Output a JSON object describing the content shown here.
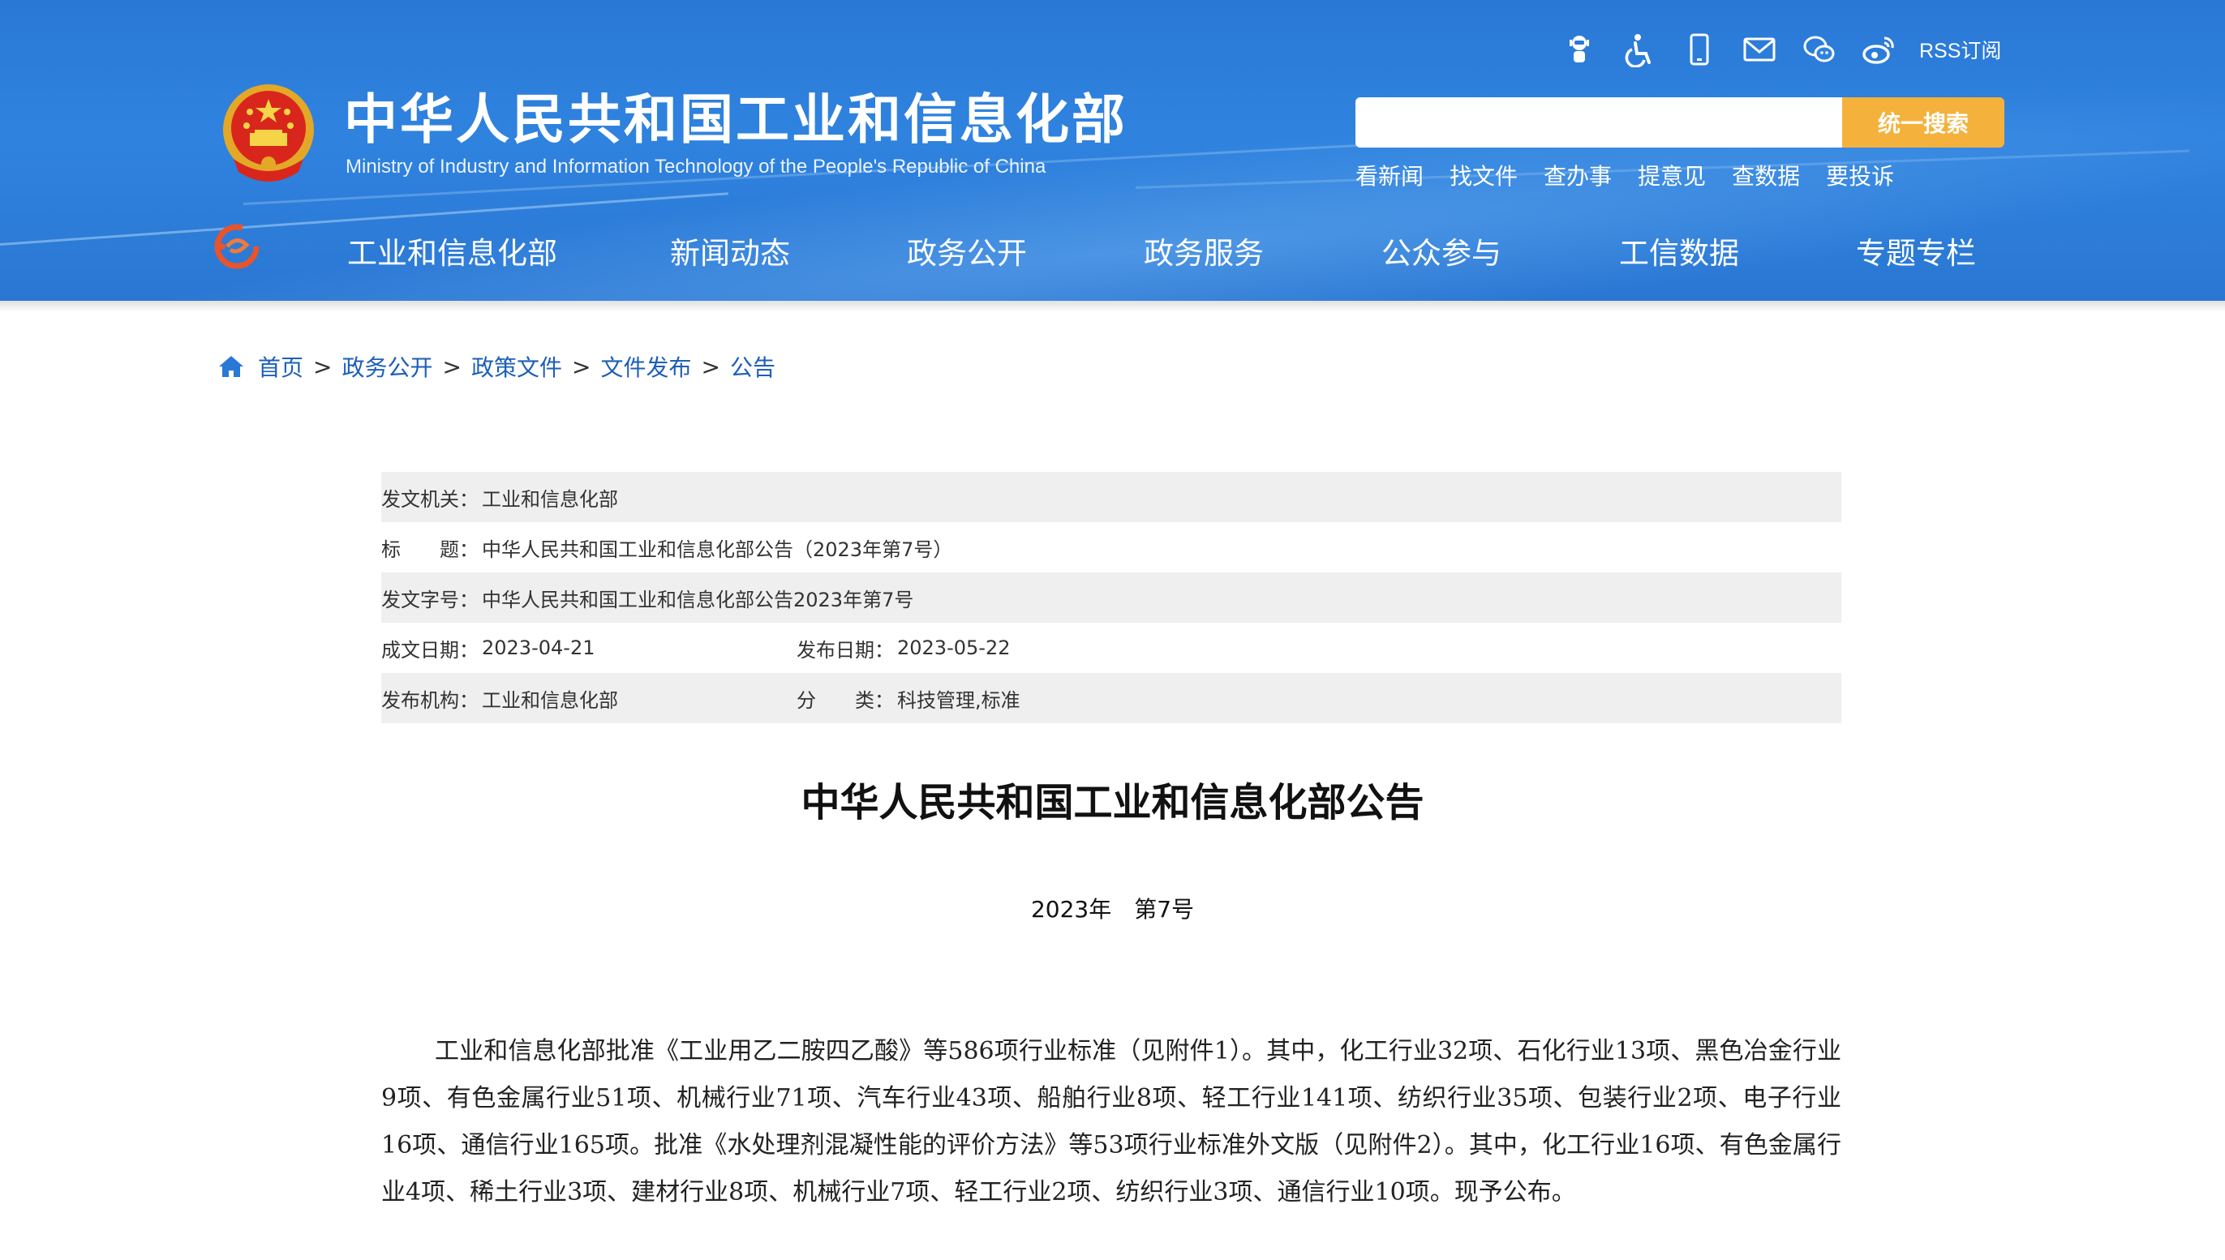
{
  "site": {
    "title": "中华人民共和国工业和信息化部",
    "subtitle": "Ministry of Industry and Information Technology of the People's Republic of China",
    "header_color": "#2f83df",
    "accent_color": "#f4b23c"
  },
  "utility": {
    "icons": [
      "robot-icon",
      "accessibility-icon",
      "mobile-icon",
      "mail-icon",
      "wechat-icon",
      "weibo-icon"
    ],
    "rss_label": "RSS订阅"
  },
  "search": {
    "placeholder": "",
    "button_label": "统一搜索",
    "quick_links": [
      "看新闻",
      "找文件",
      "查办事",
      "提意见",
      "查数据",
      "要投诉"
    ]
  },
  "nav": {
    "items": [
      "工业和信息化部",
      "新闻动态",
      "政务公开",
      "政务服务",
      "公众参与",
      "工信数据",
      "专题专栏"
    ]
  },
  "breadcrumb": {
    "items": [
      "首页",
      "政务公开",
      "政策文件",
      "文件发布",
      "公告"
    ],
    "separator": ">"
  },
  "info": {
    "issuer_label": "发文机关：",
    "issuer": "工业和信息化部",
    "title_label": "标　　题：",
    "title": "中华人民共和国工业和信息化部公告（2023年第7号）",
    "docno_label": "发文字号：",
    "docno": "中华人民共和国工业和信息化部公告2023年第7号",
    "created_label": "成文日期：",
    "created": "2023-04-21",
    "published_label": "发布日期：",
    "published": "2023-05-22",
    "org_label": "发布机构：",
    "org": "工业和信息化部",
    "category_label": "分　　类：",
    "category": "科技管理,标准"
  },
  "document": {
    "title": "中华人民共和国工业和信息化部公告",
    "number": "2023年　第7号",
    "body": "工业和信息化部批准《工业用乙二胺四乙酸》等586项行业标准（见附件1）。其中，化工行业32项、石化行业13项、黑色冶金行业9项、有色金属行业51项、机械行业71项、汽车行业43项、船舶行业8项、轻工行业141项、纺织行业35项、包装行业2项、电子行业16项、通信行业165项。批准《水处理剂混凝性能的评价方法》等53项行业标准外文版（见附件2）。其中，化工行业16项、有色金属行业4项、稀土行业3项、建材行业8项、机械行业7项、轻工行业2项、纺织行业3项、通信行业10项。现予公布。"
  }
}
